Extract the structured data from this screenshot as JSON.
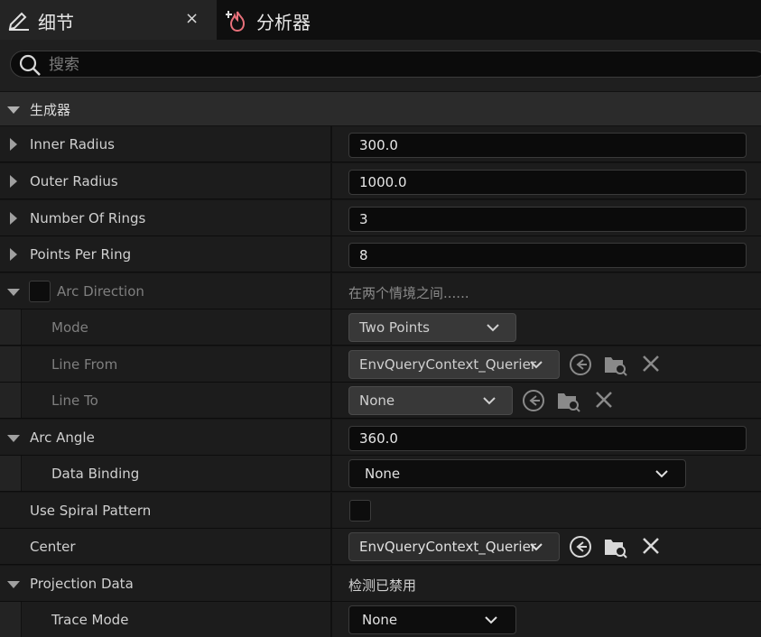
{
  "tabs": [
    {
      "label": "细节",
      "icon": "pencil-icon",
      "active": true,
      "close": "×"
    },
    {
      "label": "分析器",
      "icon": "profiler-flame-icon",
      "active": false
    }
  ],
  "search": {
    "placeholder": "搜索"
  },
  "category": {
    "title": "生成器"
  },
  "rows": {
    "inner_radius": {
      "label": "Inner Radius",
      "value": "300.0"
    },
    "outer_radius": {
      "label": "Outer Radius",
      "value": "1000.0"
    },
    "number_of_rings": {
      "label": "Number Of Rings",
      "value": "3"
    },
    "points_per_ring": {
      "label": "Points Per Ring",
      "value": "8"
    },
    "arc_direction": {
      "label": "Arc Direction",
      "value": "在两个情境之间......",
      "checked": false
    },
    "mode": {
      "label": "Mode",
      "value": "Two Points"
    },
    "line_from": {
      "label": "Line From",
      "value": "EnvQueryContext_Querier"
    },
    "line_to": {
      "label": "Line To",
      "value": "None"
    },
    "arc_angle": {
      "label": "Arc Angle",
      "value": "360.0"
    },
    "data_binding": {
      "label": "Data Binding",
      "value": "None"
    },
    "use_spiral_pattern": {
      "label": "Use Spiral Pattern",
      "checked": false
    },
    "center": {
      "label": "Center",
      "value": "EnvQueryContext_Querier"
    },
    "projection_data": {
      "label": "Projection Data",
      "value": "检测已禁用"
    },
    "trace_mode": {
      "label": "Trace Mode",
      "value": "None"
    }
  },
  "colors": {
    "background": "#151515",
    "text": "#d0d0d0",
    "dim_text": "#7f7f7f",
    "accent_icon": "#e8707a"
  }
}
